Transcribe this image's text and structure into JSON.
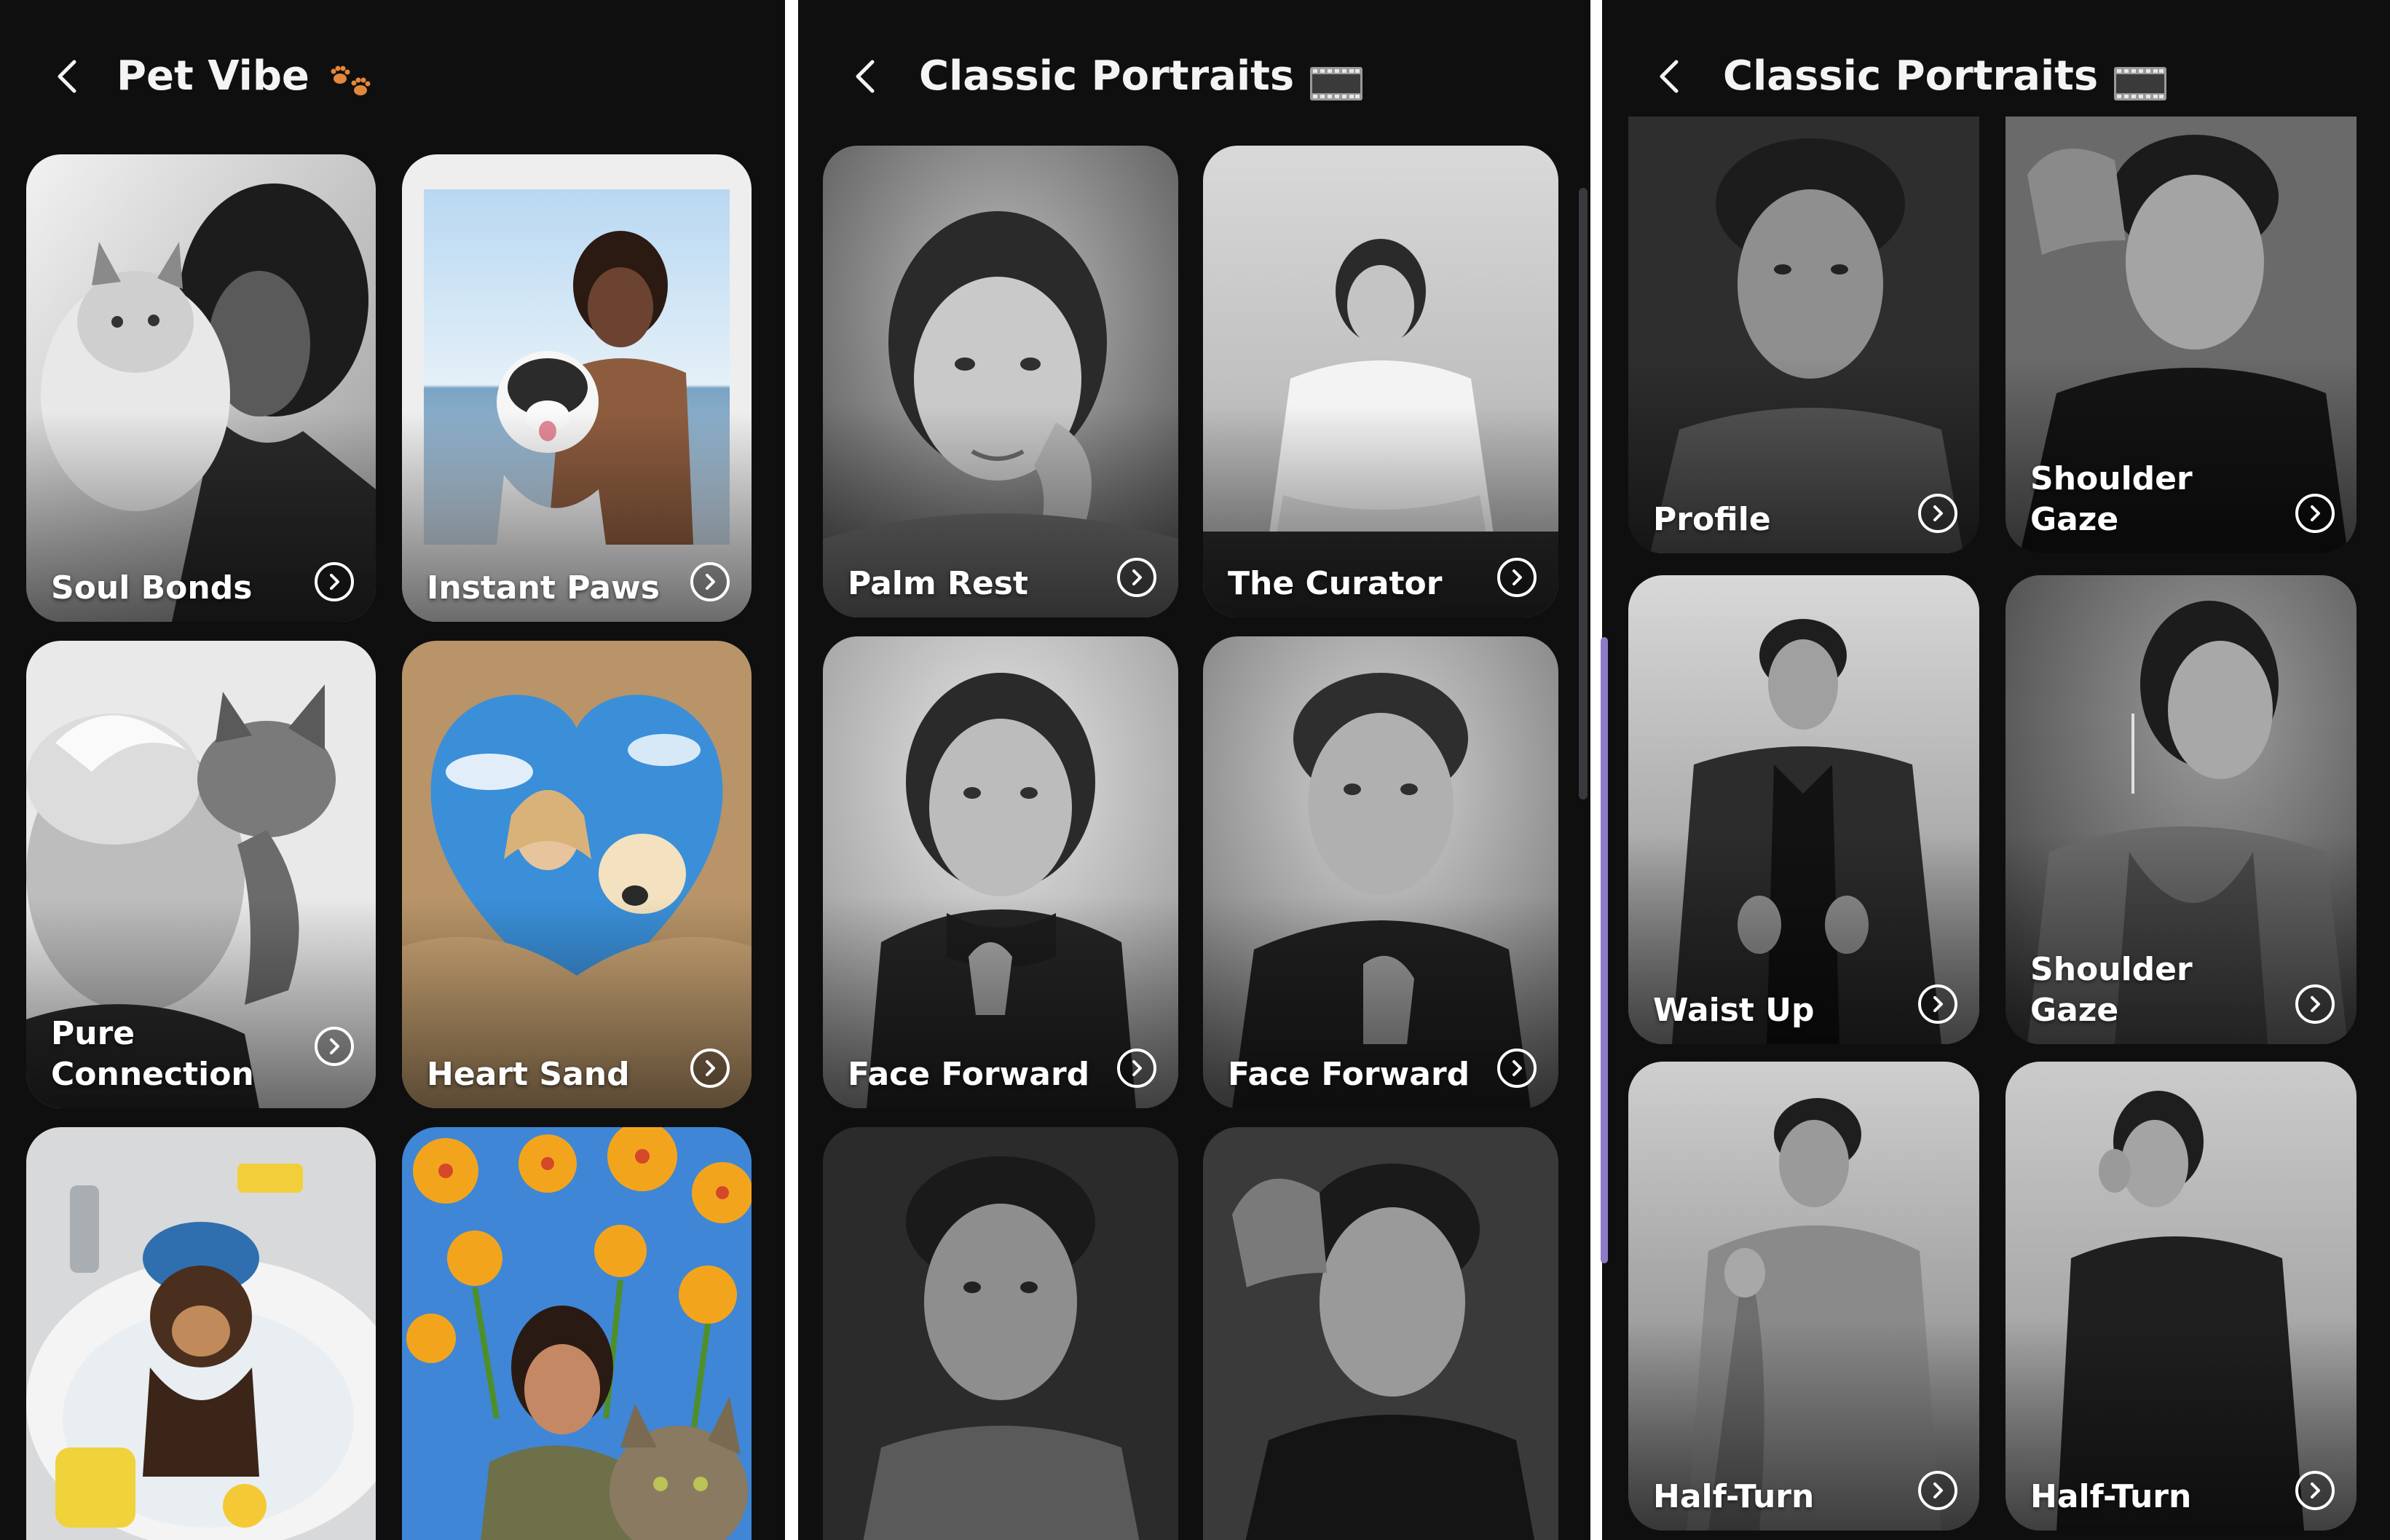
{
  "panels": [
    {
      "title": "Pet Vibe",
      "title_emoji": "paw-prints-icon",
      "cards": [
        {
          "label": "Soul Bonds"
        },
        {
          "label": "Instant Paws"
        },
        {
          "label": "Pure\nConnection"
        },
        {
          "label": "Heart Sand"
        },
        {
          "label": ""
        },
        {
          "label": ""
        }
      ]
    },
    {
      "title": "Classic Portraits",
      "title_emoji": "film-strip-icon",
      "cards": [
        {
          "label": "Palm Rest"
        },
        {
          "label": "The Curator"
        },
        {
          "label": "Face Forward"
        },
        {
          "label": "Face Forward"
        },
        {
          "label": ""
        },
        {
          "label": ""
        }
      ]
    },
    {
      "title": "Classic Portraits",
      "title_emoji": "film-strip-icon",
      "cards": [
        {
          "label": "Profile"
        },
        {
          "label": "Shoulder Gaze"
        },
        {
          "label": "Waist Up"
        },
        {
          "label": "Shoulder Gaze"
        },
        {
          "label": "Half-Turn"
        },
        {
          "label": "Half-Turn"
        }
      ]
    }
  ],
  "colors": {
    "background": "#0f0f10",
    "text": "#f4f4f4",
    "scroll_accent": "#8d7bc9"
  }
}
